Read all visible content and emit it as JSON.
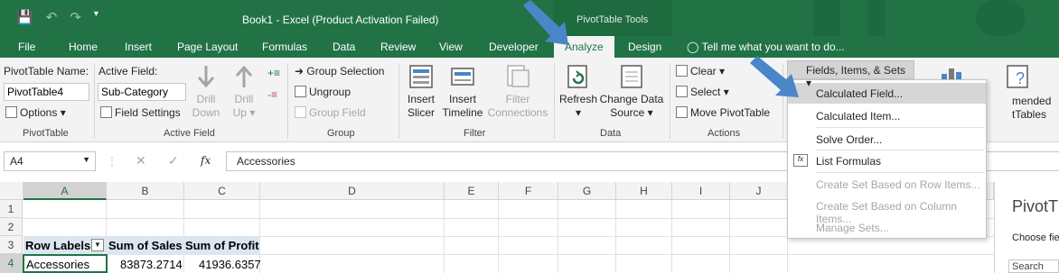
{
  "title_bar": {
    "document_title": "Book1 - Excel (Product Activation Failed)",
    "contextual_header": "PivotTable Tools",
    "qat_icons": [
      "save-icon",
      "undo-icon",
      "redo-icon",
      "customize-qat-icon"
    ]
  },
  "tabs": [
    "File",
    "Home",
    "Insert",
    "Page Layout",
    "Formulas",
    "Data",
    "Review",
    "View",
    "Developer",
    "Analyze",
    "Design"
  ],
  "active_tab": "Analyze",
  "tell_me": "Tell me what you want to do...",
  "ribbon": {
    "pivottable": {
      "name_label": "PivotTable Name:",
      "name_value": "PivotTable4",
      "options": "Options",
      "group": "PivotTable"
    },
    "active_field": {
      "label": "Active Field:",
      "value": "Sub-Category",
      "field_settings": "Field Settings",
      "drill_down_1": "Drill",
      "drill_down_2": "Down",
      "drill_up_1": "Drill",
      "drill_up_2": "Up",
      "group": "Active Field"
    },
    "group_grp": {
      "group_selection": "Group Selection",
      "ungroup": "Ungroup",
      "group_field": "Group Field",
      "group": "Group"
    },
    "filter": {
      "insert_slicer_1": "Insert",
      "insert_slicer_2": "Slicer",
      "insert_timeline_1": "Insert",
      "insert_timeline_2": "Timeline",
      "filter_connections_1": "Filter",
      "filter_connections_2": "Connections",
      "group": "Filter"
    },
    "data": {
      "refresh": "Refresh",
      "change_source_1": "Change Data",
      "change_source_2": "Source",
      "group": "Data"
    },
    "actions": {
      "clear": "Clear",
      "select": "Select",
      "move": "Move PivotTable",
      "group": "Actions"
    },
    "calculations": {
      "fields_items_sets": "Fields, Items, & Sets"
    },
    "partial_right": {
      "line1": "mended",
      "line2": "tTables"
    }
  },
  "dropdown": {
    "items": [
      {
        "label": "Calculated Field...",
        "enabled": true,
        "highlighted": true
      },
      {
        "label": "Calculated Item...",
        "enabled": true
      },
      {
        "label": "Solve Order...",
        "enabled": true
      },
      {
        "label": "List Formulas",
        "enabled": true
      },
      {
        "label": "Create Set Based on Row Items...",
        "enabled": false
      },
      {
        "label": "Create Set Based on Column Items...",
        "enabled": false
      },
      {
        "label": "Manage Sets...",
        "enabled": false
      }
    ]
  },
  "formula_bar": {
    "name_box": "A4",
    "fx": "fx",
    "content": "Accessories"
  },
  "columns": [
    "A",
    "B",
    "C",
    "D",
    "E",
    "F",
    "G",
    "H",
    "I",
    "J"
  ],
  "rows": [
    "1",
    "2",
    "3",
    "4"
  ],
  "cells": {
    "a3": "Row Labels",
    "b3": "Sum of Sales",
    "c3": "Sum of Profit",
    "a4": "Accessories",
    "b4": "83873.2714",
    "c4": "41936.6357"
  },
  "pivot_pane": {
    "title": "PivotT",
    "choose": "Choose fie",
    "search": "Search"
  },
  "colors": {
    "excel_green": "#217346",
    "arrow_blue": "#4a86c8"
  }
}
